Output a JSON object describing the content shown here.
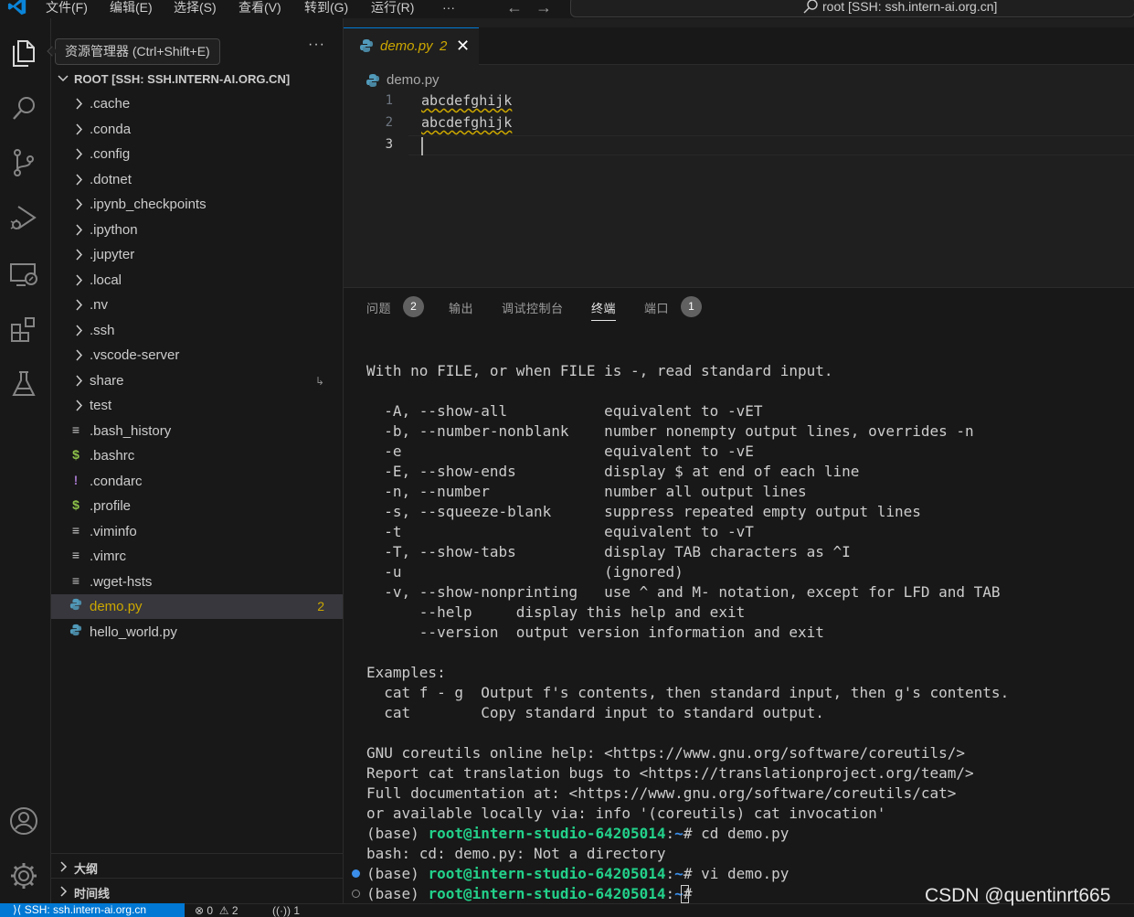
{
  "menu": {
    "file": "文件(F)",
    "edit": "编辑(E)",
    "selection": "选择(S)",
    "view": "查看(V)",
    "goto": "转到(G)",
    "run": "运行(R)",
    "more": "···"
  },
  "command_center": {
    "text": "root [SSH: ssh.intern-ai.org.cn]"
  },
  "tooltip": "资源管理器 (Ctrl+Shift+E)",
  "explorer": {
    "more": "···",
    "root_title": "ROOT [SSH: SSH.INTERN-AI.ORG.CN]",
    "items": [
      {
        "label": ".cache",
        "kind": "folder"
      },
      {
        "label": ".conda",
        "kind": "folder"
      },
      {
        "label": ".config",
        "kind": "folder"
      },
      {
        "label": ".dotnet",
        "kind": "folder"
      },
      {
        "label": ".ipynb_checkpoints",
        "kind": "folder"
      },
      {
        "label": ".ipython",
        "kind": "folder"
      },
      {
        "label": ".jupyter",
        "kind": "folder"
      },
      {
        "label": ".local",
        "kind": "folder"
      },
      {
        "label": ".nv",
        "kind": "folder"
      },
      {
        "label": ".ssh",
        "kind": "folder"
      },
      {
        "label": ".vscode-server",
        "kind": "folder"
      },
      {
        "label": "share",
        "kind": "folder"
      },
      {
        "label": "test",
        "kind": "folder"
      },
      {
        "label": ".bash_history",
        "kind": "text",
        "glyph": "≡"
      },
      {
        "label": ".bashrc",
        "kind": "shell",
        "glyph": "$"
      },
      {
        "label": ".condarc",
        "kind": "yaml",
        "glyph": "!"
      },
      {
        "label": ".profile",
        "kind": "shell",
        "glyph": "$"
      },
      {
        "label": ".viminfo",
        "kind": "text",
        "glyph": "≡"
      },
      {
        "label": ".vimrc",
        "kind": "text",
        "glyph": "≡"
      },
      {
        "label": ".wget-hsts",
        "kind": "text",
        "glyph": "≡"
      },
      {
        "label": "demo.py",
        "kind": "python",
        "badge": "2"
      },
      {
        "label": "hello_world.py",
        "kind": "python"
      }
    ],
    "sections": {
      "outline": "大纲",
      "timeline": "时间线"
    }
  },
  "editor": {
    "tab_label": "demo.py",
    "tab_badge": "2",
    "breadcrumb": "demo.py",
    "lines": [
      {
        "no": "1",
        "text": "abcdefghijk"
      },
      {
        "no": "2",
        "text": "abcdefghijk"
      },
      {
        "no": "3",
        "text": ""
      }
    ]
  },
  "panel": {
    "tabs": {
      "problems": "问题",
      "problems_count": "2",
      "output": "输出",
      "debug": "调试控制台",
      "terminal": "终端",
      "ports": "端口",
      "ports_count": "1"
    },
    "terminal_lines": [
      "With no FILE, or when FILE is -, read standard input.",
      "",
      "  -A, --show-all           equivalent to -vET",
      "  -b, --number-nonblank    number nonempty output lines, overrides -n",
      "  -e                       equivalent to -vE",
      "  -E, --show-ends          display $ at end of each line",
      "  -n, --number             number all output lines",
      "  -s, --squeeze-blank      suppress repeated empty output lines",
      "  -t                       equivalent to -vT",
      "  -T, --show-tabs          display TAB characters as ^I",
      "  -u                       (ignored)",
      "  -v, --show-nonprinting   use ^ and M- notation, except for LFD and TAB",
      "      --help     display this help and exit",
      "      --version  output version information and exit",
      "",
      "Examples:",
      "  cat f - g  Output f's contents, then standard input, then g's contents.",
      "  cat        Copy standard input to standard output.",
      "",
      "GNU coreutils online help: <https://www.gnu.org/software/coreutils/>",
      "Report cat translation bugs to <https://translationproject.org/team/>",
      "Full documentation at: <https://www.gnu.org/software/coreutils/cat>",
      "or available locally via: info '(coreutils) cat invocation'"
    ],
    "prompt": {
      "env": "(base) ",
      "user": "root@intern-studio-64205014",
      "sep": ":",
      "path": "~",
      "symbol": "# "
    },
    "commands": [
      {
        "cmd": "cd demo.py"
      },
      {
        "output": "bash: cd: demo.py: Not a directory"
      },
      {
        "cmd": "vi demo.py"
      },
      {
        "cmd": ""
      }
    ]
  },
  "status": {
    "remote": "SSH: ssh.intern-ai.org.cn",
    "errors": "0",
    "warnings": "2",
    "ports": "1"
  },
  "watermark": "CSDN @quentinrt665",
  "colors": {
    "accent": "#0078d4",
    "modified": "#cca700",
    "terminal_user": "#23d18b",
    "terminal_path": "#3b8eea"
  }
}
